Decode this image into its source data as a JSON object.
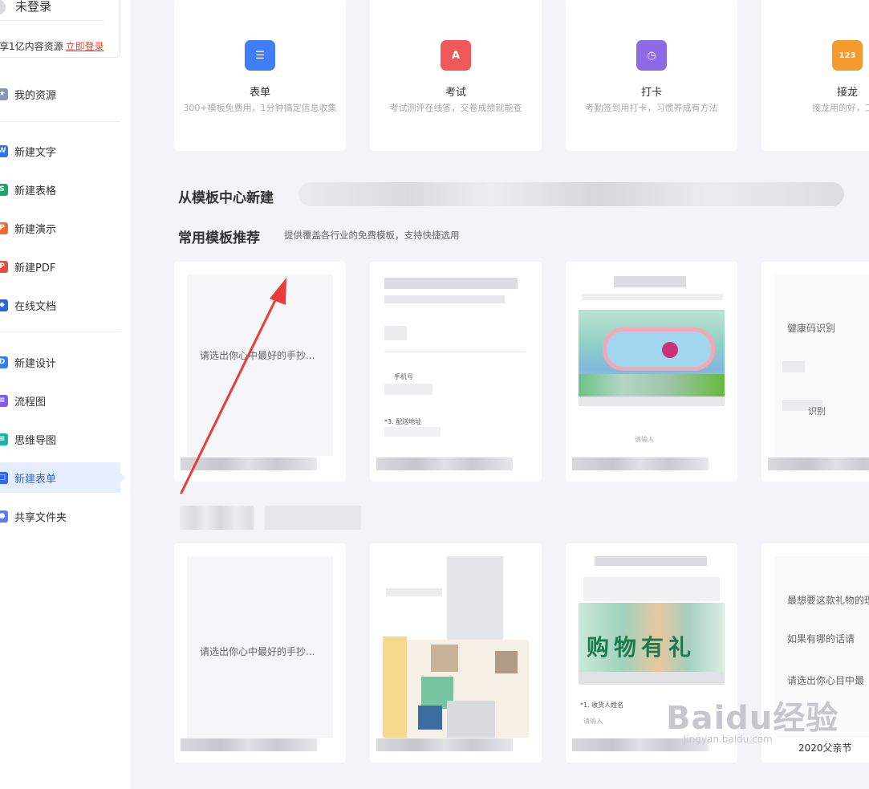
{
  "user": {
    "name": "未登录",
    "promo_text": "享1亿内容资源",
    "login_link": "立即登录"
  },
  "sidebar": {
    "items": [
      {
        "label": "我的资源",
        "icon": "resource-icon",
        "color": "#8a96b3",
        "glyph": "★"
      },
      {
        "label": "新建文字",
        "icon": "doc-icon",
        "color": "#2d74f5",
        "glyph": "W"
      },
      {
        "label": "新建表格",
        "icon": "sheet-icon",
        "color": "#17a96a",
        "glyph": "S"
      },
      {
        "label": "新建演示",
        "icon": "slides-icon",
        "color": "#f0692f",
        "glyph": "P"
      },
      {
        "label": "新建PDF",
        "icon": "pdf-icon",
        "color": "#ea4c3b",
        "glyph": "P"
      },
      {
        "label": "在线文档",
        "icon": "online-doc-icon",
        "color": "#2467e0",
        "glyph": "◆"
      },
      {
        "label": "新建设计",
        "icon": "design-icon",
        "color": "#2f7ef5",
        "glyph": "D"
      },
      {
        "label": "流程图",
        "icon": "flowchart-icon",
        "color": "#7c5cf5",
        "glyph": "≡"
      },
      {
        "label": "思维导图",
        "icon": "mindmap-icon",
        "color": "#15b6a6",
        "glyph": "≡"
      },
      {
        "label": "新建表单",
        "icon": "form-icon",
        "color": "#2c68f0",
        "glyph": "□"
      },
      {
        "label": "共享文件夹",
        "icon": "shared-folder-icon",
        "color": "#5b7cf2",
        "glyph": "●"
      }
    ]
  },
  "apps": [
    {
      "title": "表单",
      "desc": "300+模板免费用，1分钟搞定信息收集",
      "icon": "form-list-icon",
      "color": "#3f7ef6",
      "glyph": "☰"
    },
    {
      "title": "考试",
      "desc": "考试测评在线答，交卷成绩就能查",
      "icon": "exam-icon",
      "color": "#f0585a",
      "glyph": "A"
    },
    {
      "title": "打卡",
      "desc": "考勤签到用打卡，习惯养成有方法",
      "icon": "checkin-icon",
      "color": "#8e6ae6",
      "glyph": "◷"
    },
    {
      "title": "接龙",
      "desc": "接龙用的好，工作",
      "icon": "relay-icon",
      "color": "#f59a2c",
      "glyph": "123"
    }
  ],
  "sections": {
    "template_center": "从模板中心新建",
    "recommended": "常用模板推荐",
    "recommended_sub": "提供覆盖各行业的免费模板，支持快捷选用"
  },
  "templates": {
    "row1": {
      "card1_text": "请选出你心中最好的手抄...",
      "card2_field1": "*3. 配送地址",
      "card2_small": "手机号",
      "card3_small": "请输入",
      "card4_text1": "健康码识别",
      "card4_text2": "识别"
    },
    "row2": {
      "card1_text": "请选出你心中最好的手抄...",
      "card3_field": "*1. 收货人姓名",
      "card3_small": "请输入",
      "card3_banner": "购物有礼",
      "card4_text1": "最想要这款礼物的理",
      "card4_text2": "如果有哪的话请",
      "card4_text3": "请选出你心目中最",
      "card4_name": "2020父亲节"
    }
  },
  "watermark": {
    "brand": "Baidu经验",
    "domain": "jingyan.baidu.com"
  }
}
